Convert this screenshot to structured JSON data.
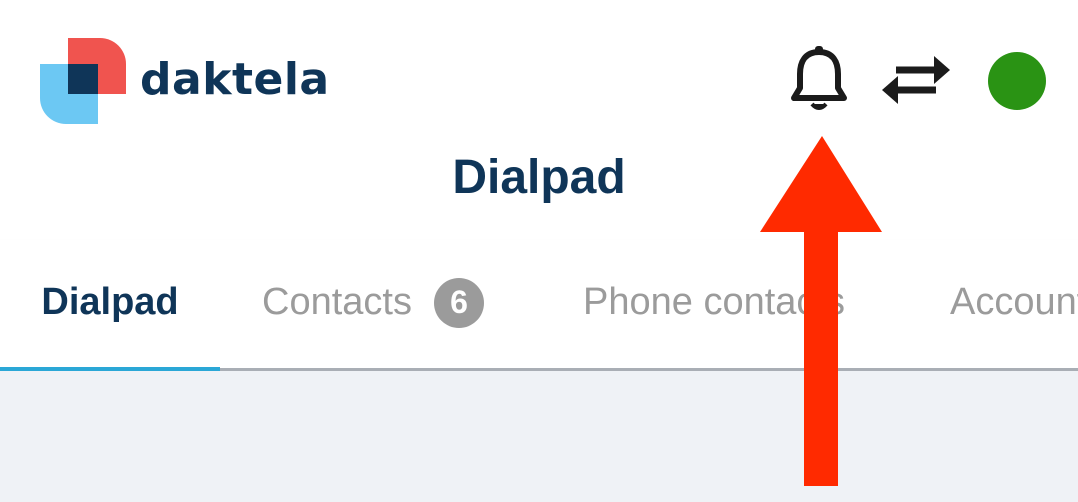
{
  "header": {
    "logo_text": "daktela",
    "title": "Dialpad"
  },
  "icons": {
    "notifications": "bell-icon",
    "switch": "swap-arrows-icon"
  },
  "status": {
    "color": "#2a9314"
  },
  "tabs": [
    {
      "label": "Dialpad",
      "active": true
    },
    {
      "label": "Contacts",
      "badge": "6"
    },
    {
      "label": "Phone contacts"
    },
    {
      "label": "Account"
    }
  ],
  "colors": {
    "brand_navy": "#0f3558",
    "tab_underline": "#2aa7d6",
    "annotation_arrow": "#ff2a00",
    "content_bg": "#eff2f6"
  }
}
